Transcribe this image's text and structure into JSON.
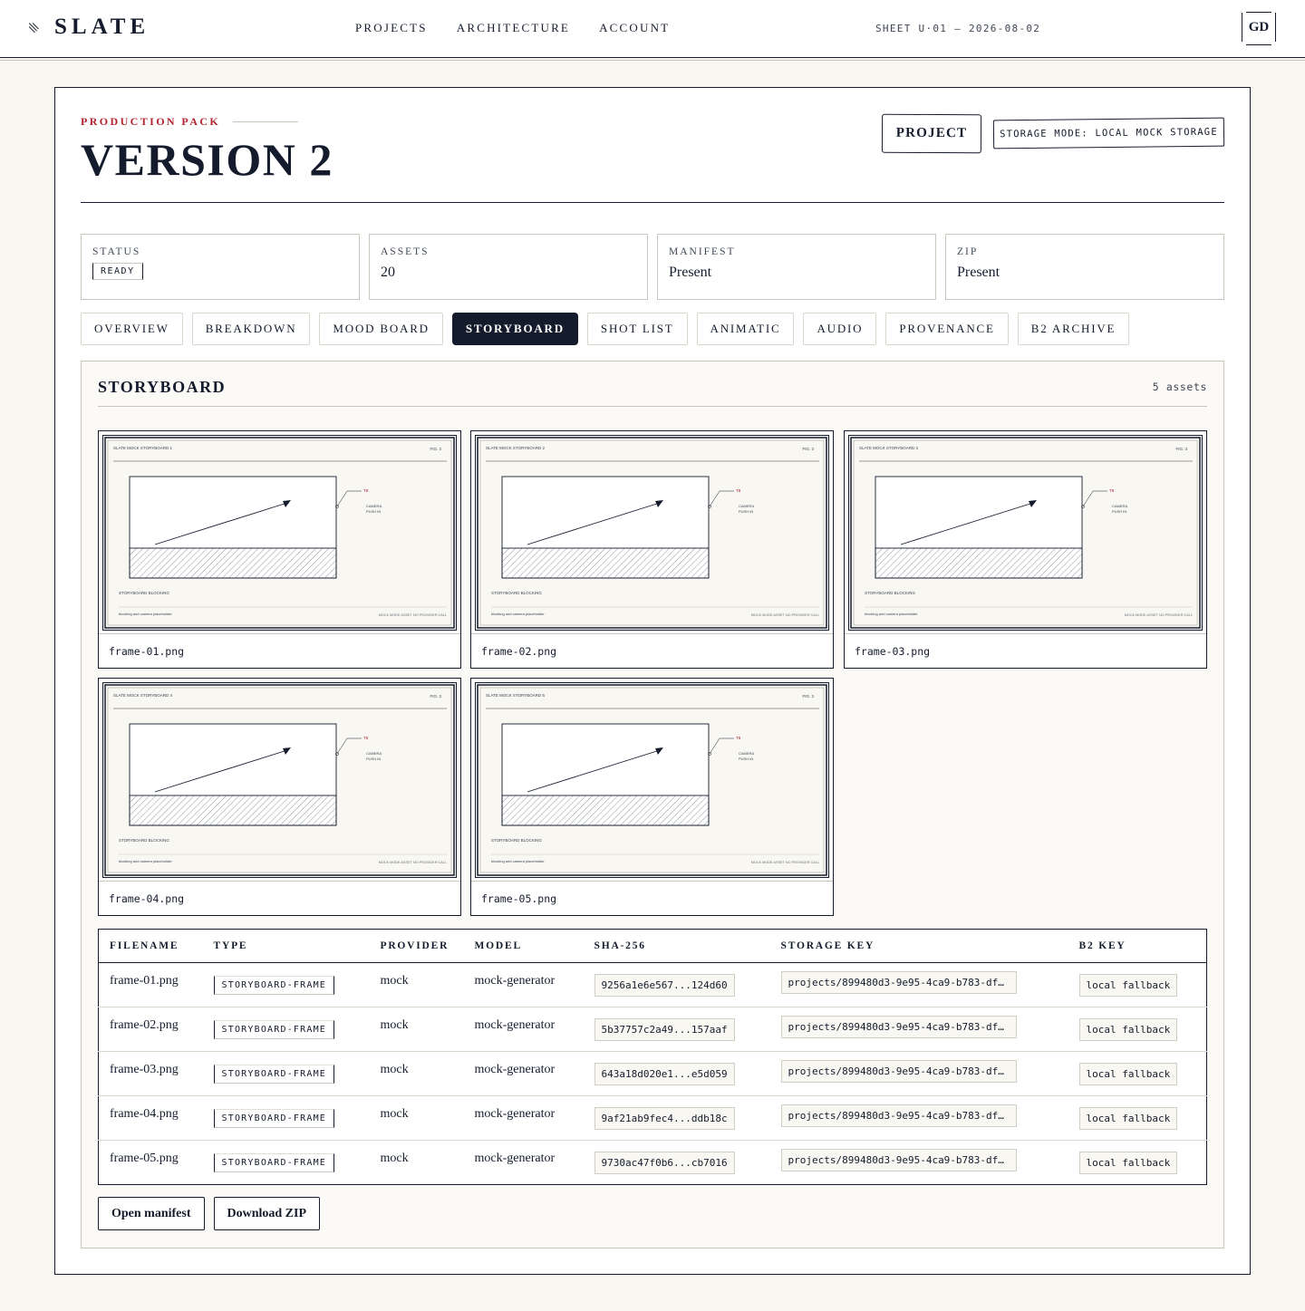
{
  "app": {
    "name": "SLATE"
  },
  "nav": {
    "items": [
      "PROJECTS",
      "ARCHITECTURE",
      "ACCOUNT"
    ]
  },
  "sheet_label": "SHEET U·01 — 2026-08-02",
  "user": {
    "initials": "GD"
  },
  "header": {
    "eyebrow": "PRODUCTION PACK",
    "title": "VERSION 2",
    "project_button": "PROJECT",
    "storage_mode": "STORAGE MODE: LOCAL MOCK STORAGE"
  },
  "stats": [
    {
      "label": "STATUS",
      "value": "READY"
    },
    {
      "label": "ASSETS",
      "value": "20"
    },
    {
      "label": "MANIFEST",
      "value": "Present"
    },
    {
      "label": "ZIP",
      "value": "Present"
    }
  ],
  "tabs": [
    {
      "label": "OVERVIEW",
      "active": false
    },
    {
      "label": "BREAKDOWN",
      "active": false
    },
    {
      "label": "MOOD BOARD",
      "active": false
    },
    {
      "label": "STORYBOARD",
      "active": true
    },
    {
      "label": "SHOT LIST",
      "active": false
    },
    {
      "label": "ANIMATIC",
      "active": false
    },
    {
      "label": "AUDIO",
      "active": false
    },
    {
      "label": "PROVENANCE",
      "active": false
    },
    {
      "label": "B2 ARCHIVE",
      "active": false
    }
  ],
  "panel": {
    "title": "STORYBOARD",
    "count": "5 assets"
  },
  "thumbnail_text": {
    "fig": "FIG. 3",
    "callout_tag": "T8",
    "callout_line1": "CAMERA",
    "callout_line2": "PUSH IN",
    "section": "STORYBOARD BLOCKING",
    "footnote": "blocking and camera placeholder",
    "footer_right": "MOCK MODE ASSET  NO PROVIDER CALL"
  },
  "frames": [
    {
      "name": "frame-01.png",
      "caption": "SLATE MOCK STORYBOARD 1"
    },
    {
      "name": "frame-02.png",
      "caption": "SLATE MOCK STORYBOARD 2"
    },
    {
      "name": "frame-03.png",
      "caption": "SLATE MOCK STORYBOARD 3"
    },
    {
      "name": "frame-04.png",
      "caption": "SLATE MOCK STORYBOARD 4"
    },
    {
      "name": "frame-05.png",
      "caption": "SLATE MOCK STORYBOARD 5"
    }
  ],
  "table": {
    "headers": [
      "FILENAME",
      "TYPE",
      "PROVIDER",
      "MODEL",
      "SHA-256",
      "STORAGE KEY",
      "B2 KEY"
    ],
    "rows": [
      {
        "filename": "frame-01.png",
        "type": "STORYBOARD-FRAME",
        "provider": "mock",
        "model": "mock-generator",
        "sha": "9256a1e6e567...124d60",
        "storage_key": "projects/899480d3-9e95-4ca9-b783-df…",
        "b2_key": "local fallback"
      },
      {
        "filename": "frame-02.png",
        "type": "STORYBOARD-FRAME",
        "provider": "mock",
        "model": "mock-generator",
        "sha": "5b37757c2a49...157aaf",
        "storage_key": "projects/899480d3-9e95-4ca9-b783-df…",
        "b2_key": "local fallback"
      },
      {
        "filename": "frame-03.png",
        "type": "STORYBOARD-FRAME",
        "provider": "mock",
        "model": "mock-generator",
        "sha": "643a18d020e1...e5d059",
        "storage_key": "projects/899480d3-9e95-4ca9-b783-df…",
        "b2_key": "local fallback"
      },
      {
        "filename": "frame-04.png",
        "type": "STORYBOARD-FRAME",
        "provider": "mock",
        "model": "mock-generator",
        "sha": "9af21ab9fec4...ddb18c",
        "storage_key": "projects/899480d3-9e95-4ca9-b783-df…",
        "b2_key": "local fallback"
      },
      {
        "filename": "frame-05.png",
        "type": "STORYBOARD-FRAME",
        "provider": "mock",
        "model": "mock-generator",
        "sha": "9730ac47f0b6...cb7016",
        "storage_key": "projects/899480d3-9e95-4ca9-b783-df…",
        "b2_key": "local fallback"
      }
    ]
  },
  "actions": {
    "open_manifest": "Open manifest",
    "download_zip": "Download ZIP"
  },
  "colors": {
    "ink": "#141b2d",
    "accent_red": "#b3232f",
    "paper": "#f8f7f1"
  }
}
